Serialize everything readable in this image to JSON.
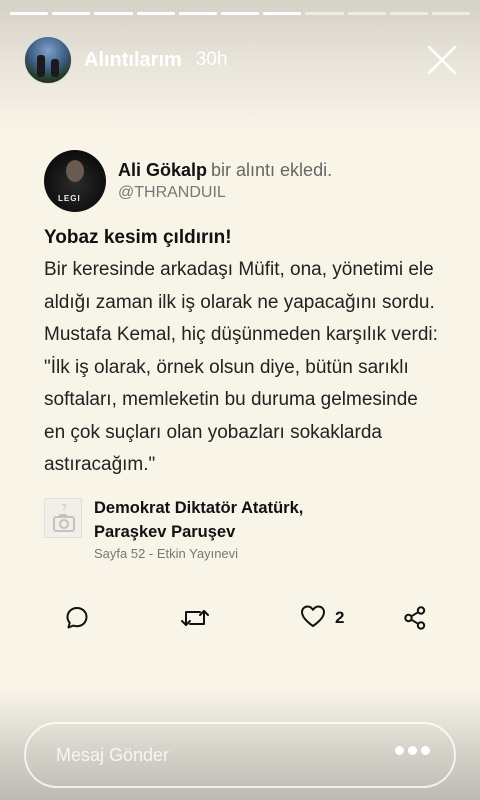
{
  "story": {
    "title": "Alıntılarım",
    "time": "30h",
    "progress_segments": 11,
    "progress_completed": 7
  },
  "post": {
    "author_name": "Ali Gökalp",
    "author_action": "bir alıntı ekledi.",
    "handle": "@THRANDUIL",
    "quote_title": "Yobaz kesim çıldırın!",
    "quote_text": "Bir keresinde arkadaşı Müfit, ona, yönetimi ele aldığı zaman ilk iş olarak ne yapacağını sordu. Mustafa Kemal, hiç düşünmeden karşılık verdi: \"İlk iş olarak, örnek olsun diye, bütün sarıklı softaları, memleketin bu duruma gelmesinde en çok suçları olan yobazları sokaklarda astıracağım.\"",
    "book": {
      "title_line1": "Demokrat Diktatör Atatürk,",
      "title_line2": "Paraşkev Paruşev",
      "meta": "Sayfa 52 - Etkin Yayınevi",
      "thumb_placeholder": "?"
    },
    "like_count": "2"
  },
  "message_bar": {
    "placeholder": "Mesaj Gönder"
  },
  "icons": {
    "comment": "comment-icon",
    "retweet": "repost-icon",
    "like": "heart-icon",
    "share": "share-icon",
    "close": "close-icon",
    "more": "more-dots-icon",
    "camera": "camera-icon"
  },
  "colors": {
    "background": "#f8f4e8",
    "text": "#111111",
    "muted": "#777777"
  }
}
